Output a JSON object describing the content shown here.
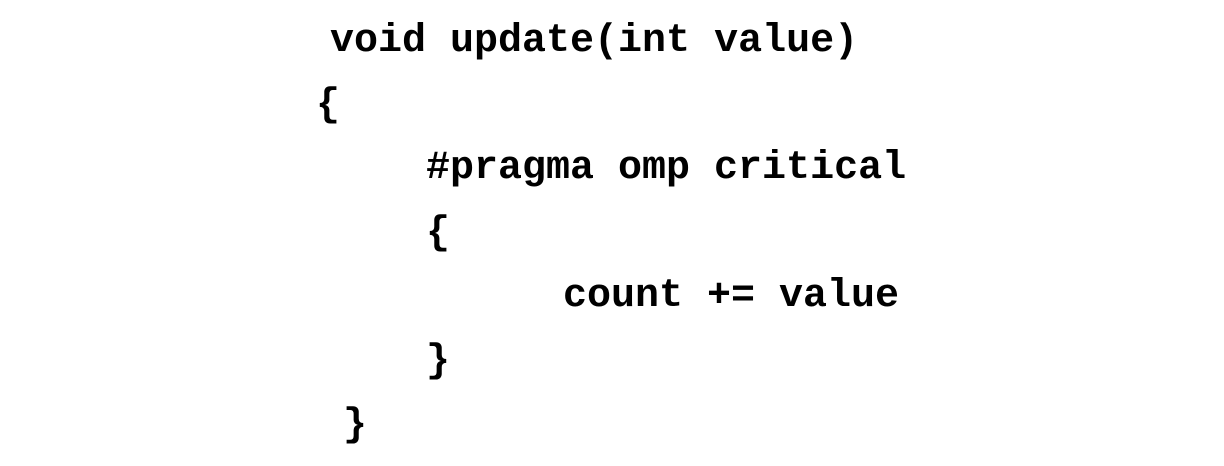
{
  "code": {
    "lines": [
      "void update(int value)",
      "{",
      "#pragma omp critical",
      "{",
      "count += value",
      "}",
      "}"
    ]
  }
}
